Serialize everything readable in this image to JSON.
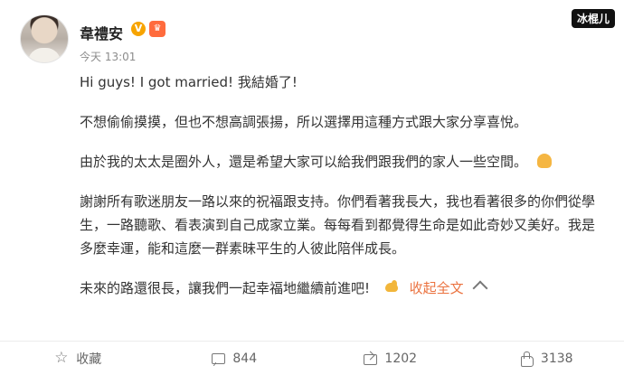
{
  "user": {
    "name": "韋禮安",
    "time": "今天 13:01"
  },
  "watermark": "冰棍儿",
  "post": {
    "lines": [
      "Hi guys! I got married! 我結婚了!",
      "不想偷偷摸摸，但也不想高調張揚，所以選擇用這種方式跟大家分享喜悅。",
      "由於我的太太是圈外人，還是希望大家可以給我們跟我們的家人一些空間。",
      "謝謝所有歌迷朋友一路以來的祝福跟支持。你們看著我長大，我也看著很多的你們從學生，一路聽歌、看表演到自己成家立業。每每看到都覺得生命是如此奇妙又美好。我是多麼幸運，能和這麼一群素昧平生的人彼此陪伴成長。",
      "未來的路還很長，讓我們一起幸福地繼續前進吧!"
    ],
    "collapse_label": "收起全文"
  },
  "footer": {
    "favorite_label": "收藏",
    "comments": "844",
    "shares": "1202",
    "likes": "3138"
  },
  "colors": {
    "accent": "#eb7340",
    "badge": "#f7a400"
  }
}
